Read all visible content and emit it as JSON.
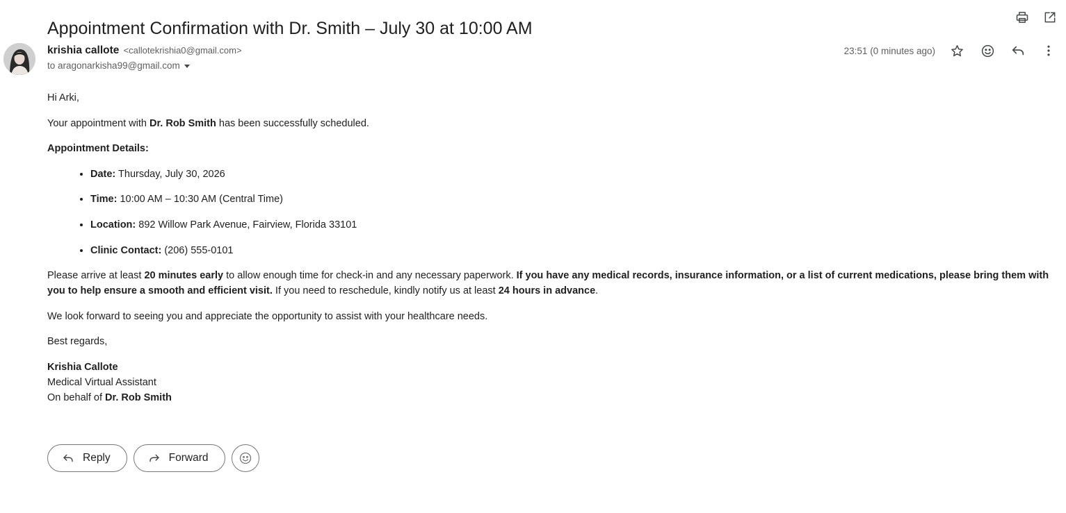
{
  "email": {
    "subject": "Appointment Confirmation with Dr. Smith – July 30 at 10:00 AM",
    "sender_name": "krishia callote",
    "sender_email": "<callotekrishia0@gmail.com>",
    "to_line": "to aragonarkisha99@gmail.com",
    "timestamp": "23:51 (0 minutes ago)"
  },
  "body": {
    "greeting": "Hi Arki,",
    "intro_pre": "Your appointment with ",
    "intro_bold": "Dr. Rob Smith",
    "intro_post": " has been successfully scheduled.",
    "details_heading": "Appointment Details:",
    "details": [
      {
        "label": "Date:",
        "value": " Thursday, July 30, 2026"
      },
      {
        "label": "Time:",
        "value": " 10:00 AM – 10:30 AM (Central Time)"
      },
      {
        "label": "Location:",
        "value": " 892 Willow Park Avenue, Fairview, Florida 33101"
      },
      {
        "label": "Clinic Contact:",
        "value": " (206) 555-0101"
      }
    ],
    "arrive_1": "Please arrive at least ",
    "arrive_bold_1": "20 minutes early",
    "arrive_2": " to allow enough time for check-in and any necessary paperwork. ",
    "arrive_bold_2": "If you have any medical records, insurance information, or a list of current medications, please bring them with you to help ensure a smooth and efficient visit.",
    "arrive_3": " If you need to reschedule, kindly notify us at least ",
    "arrive_bold_3": "24 hours in advance",
    "arrive_4": ".",
    "closing_para": "We look forward to seeing you and appreciate the opportunity to assist with your healthcare needs.",
    "regards": "Best regards,",
    "sig_name": "Krishia Callote",
    "sig_title": "Medical Virtual Assistant",
    "sig_behalf_pre": "On behalf of ",
    "sig_behalf_bold": "Dr. Rob Smith"
  },
  "actions": {
    "reply_label": "Reply",
    "forward_label": "Forward"
  },
  "icons": {
    "print": "print-icon",
    "open_new_window": "open-in-new-icon",
    "star": "star-icon",
    "emoji": "emoji-icon",
    "reply": "reply-icon",
    "more": "more-vert-icon"
  }
}
